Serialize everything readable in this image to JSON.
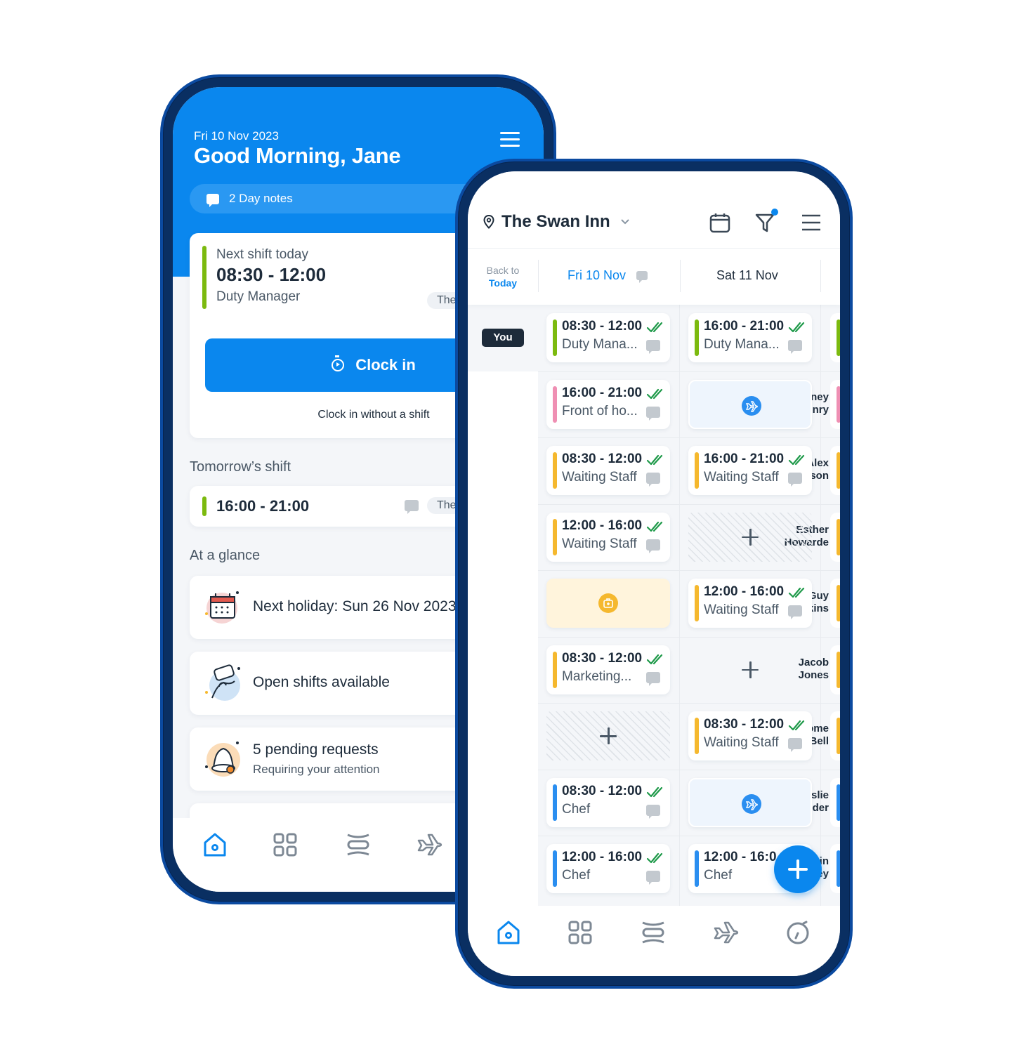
{
  "colors": {
    "brand_blue": "#0a87ee",
    "frame_navy": "#0a2f62",
    "role_duty_manager": "#7cba0f",
    "role_front_of_house": "#ef8fb3",
    "role_waiting_staff": "#f5b82e",
    "role_chef": "#2a8ef0",
    "confirmed_check": "#1f9a4a",
    "holiday_badge": "#2a8ef0",
    "sick_badge": "#f5b82e"
  },
  "home": {
    "date": "Fri 10 Nov 2023",
    "greeting": "Good Morning, Jane",
    "day_notes": "2 Day notes",
    "next_shift": {
      "label": "Next shift today",
      "time": "08:30 - 12:00",
      "role": "Duty Manager",
      "location_chip": "The"
    },
    "clock_in_label": "Clock in",
    "clock_in_without_shift": "Clock in without a shift",
    "tomorrow_title": "Tomorrow’s shift",
    "tomorrow_shift": {
      "time": "16:00 - 21:00",
      "location_chip": "The"
    },
    "glance_title": "At a glance",
    "glance_items": [
      {
        "icon": "holiday-calendar-illustration",
        "title": "Next holiday: Sun 26 Nov 2023",
        "subtitle": ""
      },
      {
        "icon": "open-shifts-illustration",
        "title": "Open shifts available",
        "subtitle": ""
      },
      {
        "icon": "bell-illustration",
        "title": "5 pending requests",
        "subtitle": "Requiring your attention"
      }
    ],
    "tabbar": [
      "home-icon",
      "dashboard-grid-icon",
      "schedule-icon",
      "leave-plane-icon"
    ]
  },
  "schedule": {
    "location": "The Swan Inn",
    "back_to": "Back to",
    "today": "Today",
    "days": [
      "Fri 10 Nov",
      "Sat 11 Nov"
    ],
    "you_label": "You",
    "rows": [
      {
        "name": [
          "",
          ""
        ],
        "you": true,
        "fri": {
          "type": "shift",
          "time": "08:30 - 12:00",
          "role": "Duty Mana...",
          "color": "#7cba0f"
        },
        "sat": {
          "type": "shift",
          "time": "16:00 - 21:00",
          "role": "Duty Mana...",
          "color": "#7cba0f"
        },
        "next_color": "#7cba0f"
      },
      {
        "name": [
          "Courtney",
          "Henry"
        ],
        "fri": {
          "type": "shift",
          "time": "16:00 - 21:00",
          "role": "Front of ho...",
          "color": "#ef8fb3"
        },
        "sat": {
          "type": "holiday"
        },
        "next_color": "#ef8fb3"
      },
      {
        "name": [
          "Alex",
          "Jackson"
        ],
        "fri": {
          "type": "shift",
          "time": "08:30 - 12:00",
          "role": "Waiting Staff",
          "color": "#f5b82e"
        },
        "sat": {
          "type": "shift",
          "time": "16:00 - 21:00",
          "role": "Waiting Staff",
          "color": "#f5b82e"
        },
        "next_color": "#f5b82e"
      },
      {
        "name": [
          "Esther",
          "Howarde"
        ],
        "fri": {
          "type": "shift",
          "time": "12:00 - 16:00",
          "role": "Waiting Staff",
          "color": "#f5b82e"
        },
        "sat": {
          "type": "unavailable"
        },
        "next_color": "#f5b82e"
      },
      {
        "name": [
          "Guy",
          "Hawkins"
        ],
        "fri": {
          "type": "sick"
        },
        "sat": {
          "type": "shift",
          "time": "12:00 - 16:00",
          "role": "Waiting Staff",
          "color": "#f5b82e"
        },
        "next_color": "#f5b82e"
      },
      {
        "name": [
          "Jacob",
          "Jones"
        ],
        "fri": {
          "type": "shift",
          "time": "08:30 - 12:00",
          "role": "Marketing...",
          "color": "#f5b82e"
        },
        "sat": {
          "type": "empty"
        },
        "next_color": "#f5b82e"
      },
      {
        "name": [
          "Jerome",
          "Bell"
        ],
        "fri": {
          "type": "unavailable"
        },
        "sat": {
          "type": "shift",
          "time": "08:30 - 12:00",
          "role": "Waiting Staff",
          "color": "#f5b82e"
        },
        "next_color": "#f5b82e"
      },
      {
        "name": [
          "Leslie",
          "Alexander"
        ],
        "fri": {
          "type": "shift",
          "time": "08:30 - 12:00",
          "role": "Chef",
          "color": "#2a8ef0"
        },
        "sat": {
          "type": "holiday"
        },
        "next_color": "#2a8ef0"
      },
      {
        "name": [
          "Marvin",
          "McKinney"
        ],
        "fri": {
          "type": "shift",
          "time": "12:00 - 16:00",
          "role": "Chef",
          "color": "#2a8ef0"
        },
        "sat": {
          "type": "shift",
          "time": "12:00 - 16:0",
          "role": "Chef",
          "color": "#2a8ef0",
          "hidden_icons": true
        },
        "next_color": "#2a8ef0"
      }
    ],
    "tabbar": [
      "home-icon",
      "dashboard-grid-icon",
      "schedule-icon",
      "leave-plane-icon",
      "timeclock-icon"
    ]
  }
}
